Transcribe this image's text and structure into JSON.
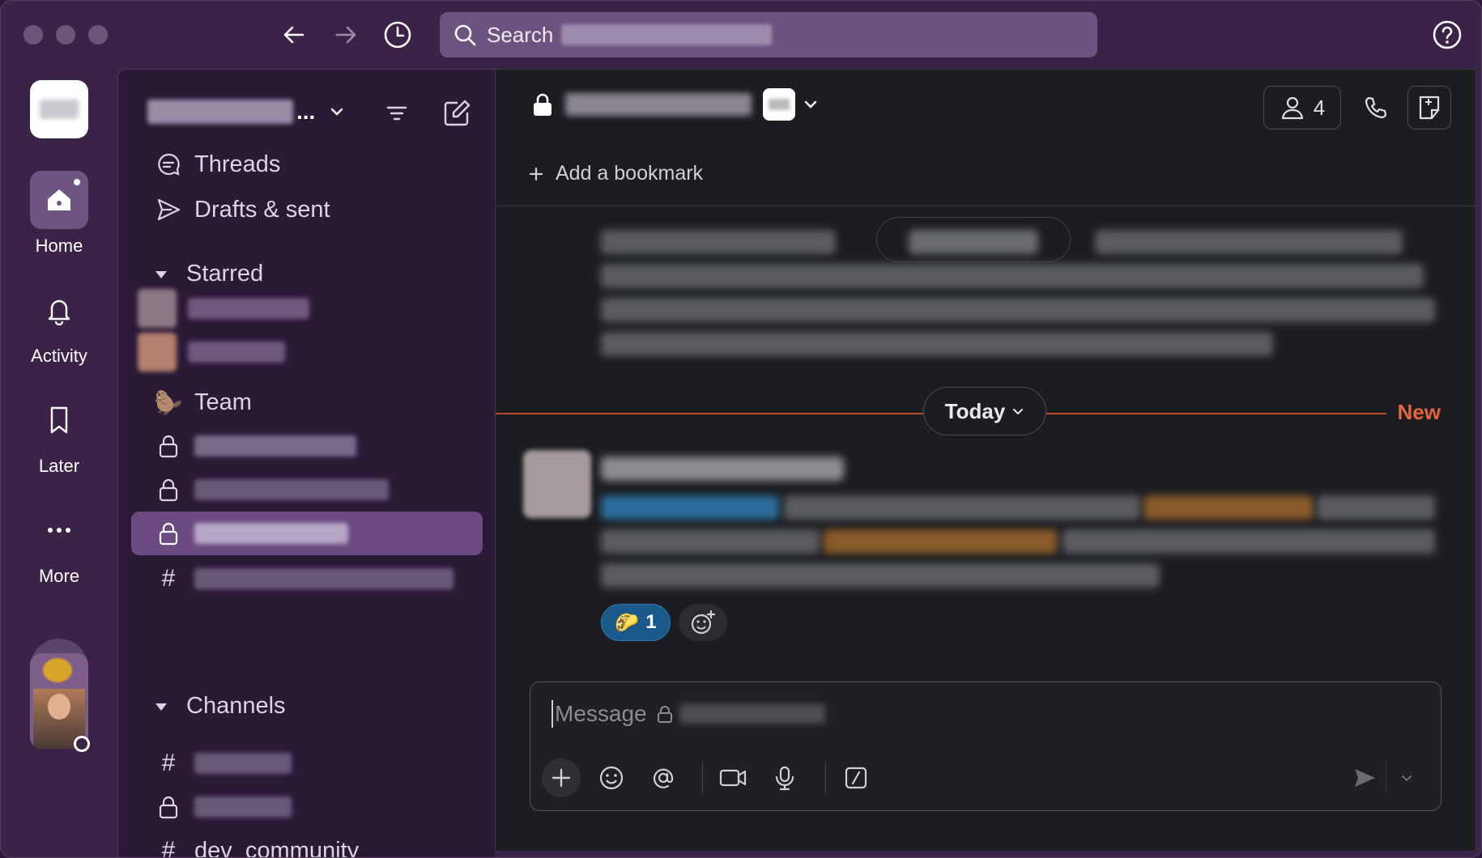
{
  "search": {
    "label": "Search"
  },
  "rail": {
    "items": [
      {
        "label": "Home"
      },
      {
        "label": "Activity"
      },
      {
        "label": "Later"
      },
      {
        "label": "More"
      }
    ]
  },
  "sidebar": {
    "workspace_suffix": "...",
    "nav": [
      {
        "label": "Threads",
        "icon": "threads-icon"
      },
      {
        "label": "Drafts & sent",
        "icon": "send-icon"
      }
    ],
    "sections": {
      "starred": "Starred",
      "team": "Team",
      "channels": "Channels"
    },
    "partial_channel": "dev_community"
  },
  "channel": {
    "member_count": "4",
    "add_bookmark": "Add a bookmark"
  },
  "messages": {
    "date_divider": "Today",
    "new_label": "New",
    "reaction_count": "1",
    "reaction_emoji": "🌮"
  },
  "composer": {
    "placeholder": "Message"
  },
  "colors": {
    "accent_new": "#e8643a",
    "window_bg": "#3b2348",
    "sidebar_bg": "#2b1a36",
    "main_bg": "#1b1d21",
    "active_row": "#6a4a80",
    "reaction_bg": "#1a5a8a"
  }
}
